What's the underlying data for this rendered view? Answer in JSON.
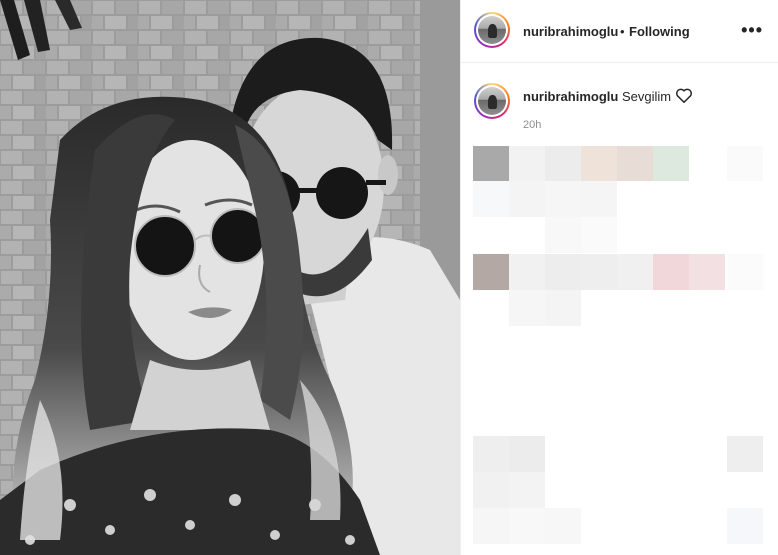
{
  "post": {
    "author": "nuribrahimoglu",
    "separator": "•",
    "follow_status": "Following",
    "more_label": "•••"
  },
  "caption": {
    "author": "nuribrahimoglu",
    "text": "Sevgilim",
    "time": "20h"
  },
  "icons": {
    "heart": "heart-icon",
    "more": "more-options-icon"
  },
  "colors": {
    "text": "#262626",
    "muted": "#8e8e8e",
    "border": "#efefef"
  }
}
